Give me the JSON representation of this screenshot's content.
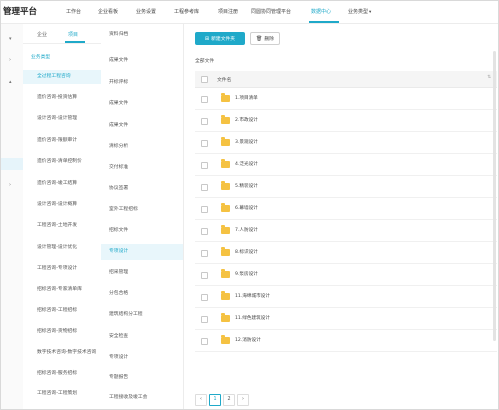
{
  "header": {
    "app_title": "管理平台",
    "nav": [
      {
        "label": "工作台"
      },
      {
        "label": "企业看板"
      },
      {
        "label": "业务设置"
      },
      {
        "label": "工程参考库"
      },
      {
        "label": "项目注册"
      },
      {
        "label": "同圆协同管理平台"
      },
      {
        "label": "数据中心"
      },
      {
        "label": "业务类型"
      }
    ],
    "active_nav": "数据中心"
  },
  "category": {
    "tabs": [
      {
        "label": "企业"
      },
      {
        "label": "项目"
      }
    ],
    "active_tab": "项目",
    "section_label": "业务类型",
    "items": [
      {
        "label": "全过程工程咨询"
      },
      {
        "label": "造价咨询-投资估算"
      },
      {
        "label": "设计咨询-设计管理"
      },
      {
        "label": "造价咨询-限额审计"
      },
      {
        "label": "造价咨询-清单控制价"
      },
      {
        "label": "造价咨询-竣工结算"
      },
      {
        "label": "设计咨询-设计概算"
      },
      {
        "label": "工程咨询-土地开发"
      },
      {
        "label": "设计管理-设计优化"
      },
      {
        "label": "工程咨询-专项设计"
      },
      {
        "label": "招标咨询-专家清单库"
      },
      {
        "label": "招标咨询-工程招标"
      },
      {
        "label": "招标咨询-货物招标"
      },
      {
        "label": "数字技术咨询-数字技术咨询"
      },
      {
        "label": "招标咨询-服务招标"
      },
      {
        "label": "工程咨询-工程策划"
      }
    ]
  },
  "subcategory": {
    "items": [
      {
        "label": "资料归档"
      },
      {
        "label": "成果文件"
      },
      {
        "label": "开标评标"
      },
      {
        "label": "成果文件"
      },
      {
        "label": "成果文件"
      },
      {
        "label": "清标分析"
      },
      {
        "label": "交付标准"
      },
      {
        "label": "协议签署"
      },
      {
        "label": "室外工程招标"
      },
      {
        "label": "招标文件"
      },
      {
        "label": "专项设计"
      },
      {
        "label": "招采管理"
      },
      {
        "label": "分包合格"
      },
      {
        "label": "建筑结构分工程"
      },
      {
        "label": "安全检查"
      },
      {
        "label": "专项设计"
      },
      {
        "label": "专题报告"
      },
      {
        "label": "工程接收及竣工会"
      }
    ]
  },
  "files": {
    "new_folder_label": "新建文件夹",
    "delete_label": "删除",
    "section_label": "全部文件",
    "column_name": "文件名",
    "rows": [
      {
        "name": "1.项目清单"
      },
      {
        "name": "2.市政设计"
      },
      {
        "name": "3.景观设计"
      },
      {
        "name": "4.泛光设计"
      },
      {
        "name": "5.精装设计"
      },
      {
        "name": "6.幕墙设计"
      },
      {
        "name": "7.人防设计"
      },
      {
        "name": "8.标识设计"
      },
      {
        "name": "9.泵房设计"
      },
      {
        "name": "11.海绵城市设计"
      },
      {
        "name": "11.绿色建筑设计"
      },
      {
        "name": "12.消防设计"
      }
    ]
  },
  "pagination": {
    "pages": [
      "1",
      "2"
    ],
    "current": "1",
    "prev": "‹",
    "next": "›"
  },
  "colors": {
    "accent": "#1fa9c9",
    "folder": "#f5c242"
  }
}
